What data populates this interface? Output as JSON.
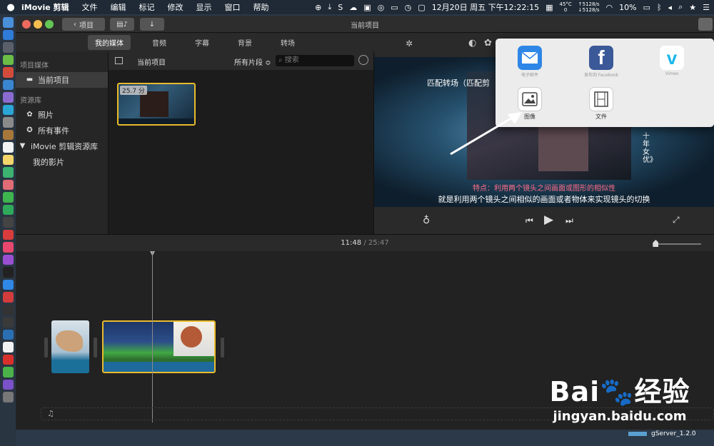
{
  "menubar": {
    "app": "iMovie 剪辑",
    "menus": [
      "文件",
      "编辑",
      "标记",
      "修改",
      "显示",
      "窗口",
      "帮助"
    ],
    "temp": "45°C",
    "temp_sub": "0",
    "net_up": "↑5128/s",
    "net_down": "↓5128/s",
    "clock": "12月20日 周五 下午12:22:15",
    "battery": "10%"
  },
  "toolbar": {
    "back_label": "项目",
    "window_title": "当前项目"
  },
  "tabs": [
    "我的媒体",
    "音频",
    "字幕",
    "背景",
    "转场"
  ],
  "sidebar": {
    "section_project": "项目媒体",
    "current_project": "当前项目",
    "section_library": "资源库",
    "photos": "照片",
    "all_events": "所有事件",
    "library_name": "iMovie 剪辑资源库",
    "my_movie": "我的影片"
  },
  "browser": {
    "title": "当前项目",
    "filter": "所有片段 ≎",
    "search_placeholder": "搜索",
    "clip_duration": "25.7 分"
  },
  "viewer": {
    "video_title": "匹配转场（匹配剪",
    "side_text": "十年女优》",
    "subtitle_red": "特点：利用两个镜头之间画面或图形的相似性",
    "subtitle_white": "就是利用两个镜头之间相似的画面或者物体来实现镜头的切换"
  },
  "share": {
    "items": [
      {
        "label": "电子邮件",
        "icon": "mail-icon",
        "dim": true
      },
      {
        "label": "发布到 Facebook",
        "icon": "facebook-icon",
        "dim": true
      },
      {
        "label": "Vimeo",
        "icon": "vimeo-icon",
        "dim": true
      },
      {
        "label": "图像",
        "icon": "image-icon",
        "dim": false
      },
      {
        "label": "文件",
        "icon": "film-icon",
        "dim": false
      }
    ]
  },
  "timeline": {
    "current": "11:48",
    "separator": "/",
    "total": "25:47",
    "zoom_level": 0.05
  },
  "watermark": {
    "logo": "Bai",
    "logo_cn": "经验",
    "url": "jingyan.baidu.com",
    "gserver": "gServer_1.2.0"
  },
  "colors": {
    "accent_yellow": "#e9bb2c",
    "menubar_bg": "#1f2a36",
    "subtitle_red": "#ff6e8a"
  }
}
